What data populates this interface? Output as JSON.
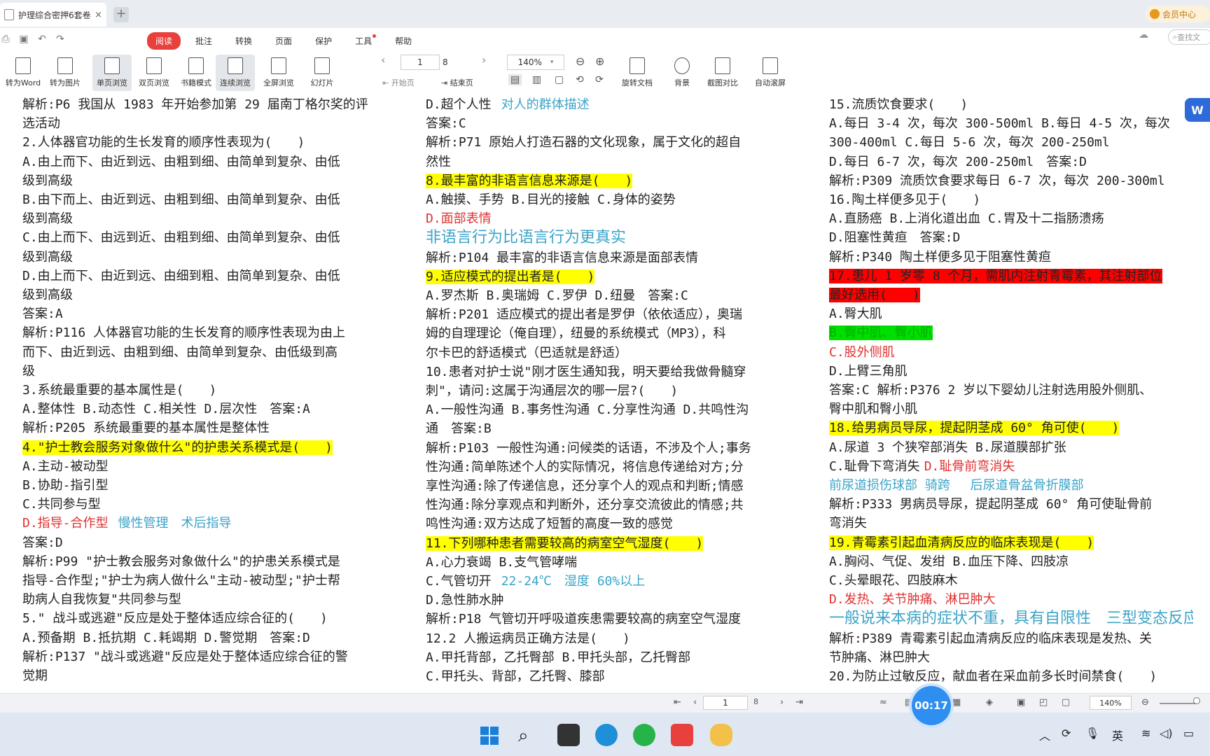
{
  "tab": {
    "title": "护理综合密押6套卷...",
    "close": "×"
  },
  "new_tab": "+",
  "vip": "会员中心",
  "menus": [
    "阅读",
    "批注",
    "转换",
    "页面",
    "保护",
    "工具",
    "帮助"
  ],
  "search_placeholder": "查找文",
  "toolbar": {
    "to_word": "转为Word",
    "to_image": "转为图片",
    "single": "单页浏览",
    "double": "双页浏览",
    "book": "书籍模式",
    "continuous": "连续浏览",
    "fullscreen": "全屏浏览",
    "slides": "幻灯片",
    "page_current": "1",
    "page_total": "8",
    "start_page": "开始页",
    "end_page": "结束页",
    "zoom": "140%",
    "rotate": "旋转文档",
    "background": "背景",
    "compare": "截图对比",
    "autoscroll": "自动滚屏"
  },
  "col1": [
    {
      "t": "解析:P6 我国从 1983 年开始参加第 29 届南丁格尔奖的评"
    },
    {
      "t": "选活动"
    },
    {
      "t": "2.人体器官功能的生长发育的顺序性表现为(　　)"
    },
    {
      "t": "A.由上而下、由近到远、由粗到细、由简单到复杂、由低"
    },
    {
      "t": "级到高级"
    },
    {
      "t": "B.由下而上、由近到远、由粗到细、由简单到复杂、由低"
    },
    {
      "t": "级到高级"
    },
    {
      "t": "C.由上而下、由远到近、由粗到细、由简单到复杂、由低"
    },
    {
      "t": "级到高级"
    },
    {
      "t": "D.由上而下、由近到远、由细到粗、由简单到复杂、由低"
    },
    {
      "t": "级到高级"
    },
    {
      "t": "答案:A"
    },
    {
      "t": "解析:P116 人体器官功能的生长发育的顺序性表现为由上"
    },
    {
      "t": "而下、由近到远、由粗到细、由简单到复杂、由低级到高"
    },
    {
      "t": "级"
    },
    {
      "t": "3.系统最重要的基本属性是(　　)"
    },
    {
      "t": "A.整体性 B.动态性 C.相关性 D.层次性　答案:A"
    },
    {
      "t": "解析:P205 系统最重要的基本属性是整体性"
    },
    {
      "t": "4.\"护士教会服务对象做什么\"的护患关系模式是(　　)",
      "s": "hl"
    },
    {
      "t": "A.主动-被动型"
    },
    {
      "t": "B.协助-指引型"
    },
    {
      "t": "C.共同参与型"
    },
    {
      "t": "D.指导-合作型",
      "s": "red",
      "extra": "慢性管理　术后指导"
    },
    {
      "t": "答案:D"
    },
    {
      "t": "解析:P99 \"护士教会服务对象做什么\"的护患关系模式是"
    },
    {
      "t": "指导-合作型;\"护士为病人做什么\"主动-被动型;\"护士帮"
    },
    {
      "t": "助病人自我恢复\"共同参与型"
    },
    {
      "t": "5.\" 战斗或逃避\"反应是处于整体适应综合征的(　　)"
    },
    {
      "t": "A.预备期 B.抵抗期 C.耗竭期 D.警觉期　答案:D"
    },
    {
      "t": "解析:P137 \"战斗或逃避\"反应是处于整体适应综合征的警"
    },
    {
      "t": "觉期"
    }
  ],
  "col2": [
    {
      "t": "D.超个人性",
      "extra": "对人的群体描述"
    },
    {
      "t": "答案:C"
    },
    {
      "t": "解析:P71 原始人打造石器的文化现象，属于文化的超自"
    },
    {
      "t": "然性"
    },
    {
      "t": "8.最丰富的非语言信息来源是(　　)",
      "s": "hl"
    },
    {
      "t": "A.触摸、手势 B.目光的接触 C.身体的姿势"
    },
    {
      "t": "D.面部表情",
      "s": "red"
    },
    {
      "t": "非语言行为比语言行为更真实",
      "s": "big"
    },
    {
      "t": "解析:P104 最丰富的非语言信息来源是面部表情"
    },
    {
      "t": "9.适应模式的提出者是(　　)",
      "s": "hl"
    },
    {
      "t": "A.罗杰斯 B.奥瑞姆 C.罗伊 D.纽曼　答案:C"
    },
    {
      "t": "解析:P201 适应模式的提出者是罗伊（依依适应），奥瑞"
    },
    {
      "t": "姆的自理理论（俺自理），纽曼的系统模式（MP3），科"
    },
    {
      "t": "尔卡巴的舒适模式（巴适就是舒适）"
    },
    {
      "t": "10.患者对护士说\"刚才医生通知我，明天要给我做骨髓穿"
    },
    {
      "t": "刺\"，请问:这属于沟通层次的哪一层?(　　)"
    },
    {
      "t": "A.一般性沟通 B.事务性沟通 C.分享性沟通 D.共鸣性沟"
    },
    {
      "t": "通　答案:B"
    },
    {
      "t": "解析:P103 一般性沟通:问候类的话语，不涉及个人;事务"
    },
    {
      "t": "性沟通:简单陈述个人的实际情况，将信息传递给对方;分"
    },
    {
      "t": "享性沟通:除了传递信息，还分享个人的观点和判断;情感"
    },
    {
      "t": "性沟通:除分享观点和判断外，还分享交流彼此的情感;共"
    },
    {
      "t": "鸣性沟通:双方达成了短暂的高度一致的感觉"
    },
    {
      "t": "11.下列哪种患者需要较高的病室空气湿度(　　)",
      "s": "hl"
    },
    {
      "t": "A.心力衰竭 B.支气管哮喘"
    },
    {
      "t": "C.气管切开",
      "extra": "22-24℃　湿度 60%以上"
    },
    {
      "t": "D.急性肺水肿"
    },
    {
      "t": "解析:P18 气管切开呼吸道疾患需要较高的病室空气湿度"
    },
    {
      "t": "12.2 人搬运病员正确方法是(　　)"
    },
    {
      "t": "A.甲托背部，乙托臀部 B.甲托头部，乙托臀部"
    },
    {
      "t": "C.甲托头、背部，乙托臀、膝部"
    }
  ],
  "col3": [
    {
      "t": "15.流质饮食要求(　　)"
    },
    {
      "t": "A.每日 3-4 次，每次 300-500ml B.每日 4-5 次，每次"
    },
    {
      "t": "300-400ml C.每日 5-6 次，每次 200-250ml"
    },
    {
      "t": "D.每日 6-7 次，每次 200-250ml　答案:D"
    },
    {
      "t": "解析:P309 流质饮食要求每日 6-7 次，每次 200-300ml"
    },
    {
      "t": "16.陶土样便多见于(　　)"
    },
    {
      "t": "A.直肠癌 B.上消化道出血 C.胃及十二指肠溃疡"
    },
    {
      "t": "D.阻塞性黄疸　答案:D"
    },
    {
      "t": "解析:P340 陶土样便多见于阻塞性黄疸"
    },
    {
      "t": "17.患儿 1 岁零 8 个月，需肌内注射青霉素，其注射部位",
      "s": "rh"
    },
    {
      "t": "最好选用(　　)",
      "s": "rh"
    },
    {
      "t": "A.臀大肌"
    },
    {
      "t": "B.臀中肌、臀小肌",
      "s": "gh"
    },
    {
      "t": "C.股外侧肌",
      "s": "red"
    },
    {
      "t": "D.上臂三角肌"
    },
    {
      "t": "答案:C 解析:P376 2 岁以下婴幼儿注射选用股外侧肌、"
    },
    {
      "t": "臀中肌和臀小肌"
    },
    {
      "t": "18.给男病员导尿，提起阴茎成 60° 角可使(　　)",
      "s": "hl"
    },
    {
      "t": "A.尿道 3 个狭窄部消失 B.尿道膜部扩张"
    },
    {
      "t": "C.耻骨下弯消失",
      "extra2": "D.耻骨前弯消失"
    },
    {
      "t": "前尿道损伤球部 骑跨　 后尿道骨盆骨折膜部",
      "s": "blue"
    },
    {
      "t": "解析:P333 男病员导尿，提起阴茎成 60° 角可使耻骨前"
    },
    {
      "t": "弯消失"
    },
    {
      "t": "19.青霉素引起血清病反应的临床表现是(　　)",
      "s": "hl"
    },
    {
      "t": "A.胸闷、气促、发绀 B.血压下降、四肢凉"
    },
    {
      "t": "C.头晕眼花、四肢麻木"
    },
    {
      "t": "D.发热、关节肿痛、淋巴肿大",
      "s": "red"
    },
    {
      "t": "一般说来本病的症状不重，具有自限性　三型变态反应",
      "s": "big"
    },
    {
      "t": "解析:P389 青霉素引起血清病反应的临床表现是发热、关"
    },
    {
      "t": "节肿痛、淋巴肿大"
    },
    {
      "t": "20.为防止过敏反应，献血者在采血前多长时间禁食(　　)"
    }
  ],
  "status": {
    "page_current": "1",
    "page_total": "8",
    "zoom": "140%"
  },
  "recording_time": "00:17",
  "tray": {
    "ime": "英"
  },
  "colors": {
    "accent": "#e8403c",
    "highlight": "#ffff00",
    "annotation_blue": "#3aa3c8",
    "annotation_red": "#e03030"
  }
}
